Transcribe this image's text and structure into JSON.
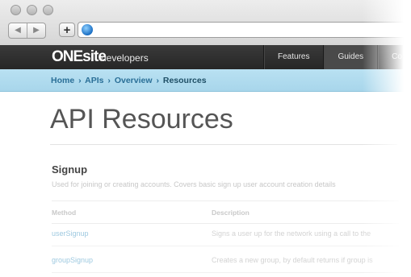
{
  "browser": {
    "nav_back": "◀",
    "nav_forward": "▶",
    "new_tab": "+"
  },
  "site": {
    "logo": "ONEsite",
    "logo_sub": "developers",
    "nav": [
      "Features",
      "Guides",
      "Co"
    ]
  },
  "breadcrumb": {
    "items": [
      "Home",
      "APIs",
      "Overview"
    ],
    "separator": "›",
    "current": "Resources"
  },
  "page": {
    "title": "API Resources"
  },
  "section": {
    "title": "Signup",
    "description": "Used for joining or creating accounts. Covers basic sign up user account creation details",
    "table": {
      "headers": [
        "Method",
        "Description"
      ],
      "rows": [
        {
          "method": "userSignup",
          "description": "Signs a user up for the network using a call to the"
        },
        {
          "method": "groupSignup",
          "description": "Creates a new group, by default returns if group is"
        }
      ]
    }
  },
  "colors": {
    "header_bg": "#2e2e2e",
    "breadcrumb_band": "#b3ddef",
    "link": "#2a6f97"
  }
}
